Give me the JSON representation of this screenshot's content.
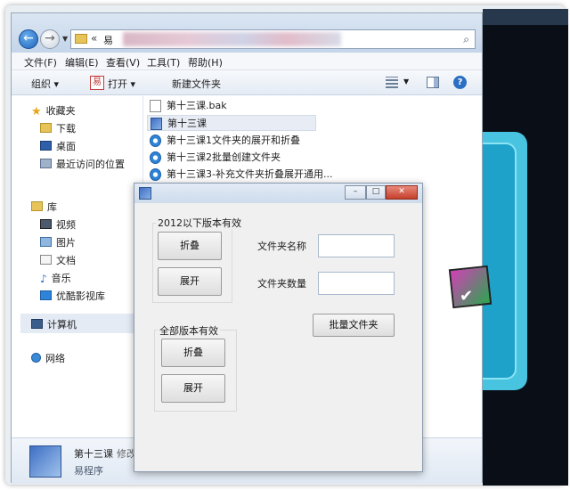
{
  "explorer": {
    "address_prefix": "易",
    "menu": [
      "文件(F)",
      "编辑(E)",
      "查看(V)",
      "工具(T)",
      "帮助(H)"
    ],
    "toolbar": {
      "organize": "组织 ▾",
      "open": "打开 ▾",
      "new_folder": "新建文件夹"
    },
    "nav": {
      "favorites": "收藏夹",
      "downloads": "下载",
      "desktop": "桌面",
      "recent": "最近访问的位置",
      "libraries": "库",
      "videos": "视频",
      "pictures": "图片",
      "documents": "文档",
      "music": "音乐",
      "youku": "优酷影视库",
      "computer": "计算机",
      "network": "网络"
    },
    "files": [
      {
        "name": "第十三课.bak",
        "icon": "doc"
      },
      {
        "name": "第十三课",
        "icon": "app",
        "selected": true
      },
      {
        "name": "第十三课1文件夹的展开和折叠",
        "icon": "media"
      },
      {
        "name": "第十三课2批量创建文件夹",
        "icon": "media"
      },
      {
        "name": "第十三课3-补充文件夹折叠展开通用...",
        "icon": "media"
      }
    ],
    "details": {
      "name": "第十三课",
      "modified": "修改",
      "type": "易程序"
    }
  },
  "dialog": {
    "group1_label": "2012以下版本有效",
    "group1_collapse": "折叠",
    "group1_expand": "展开",
    "group2_label": "全部版本有效",
    "group2_collapse": "折叠",
    "group2_expand": "展开",
    "folder_name_label": "文件夹名称",
    "folder_count_label": "文件夹数量",
    "folder_name_value": "",
    "folder_count_value": "",
    "batch_button": "批量文件夹"
  }
}
